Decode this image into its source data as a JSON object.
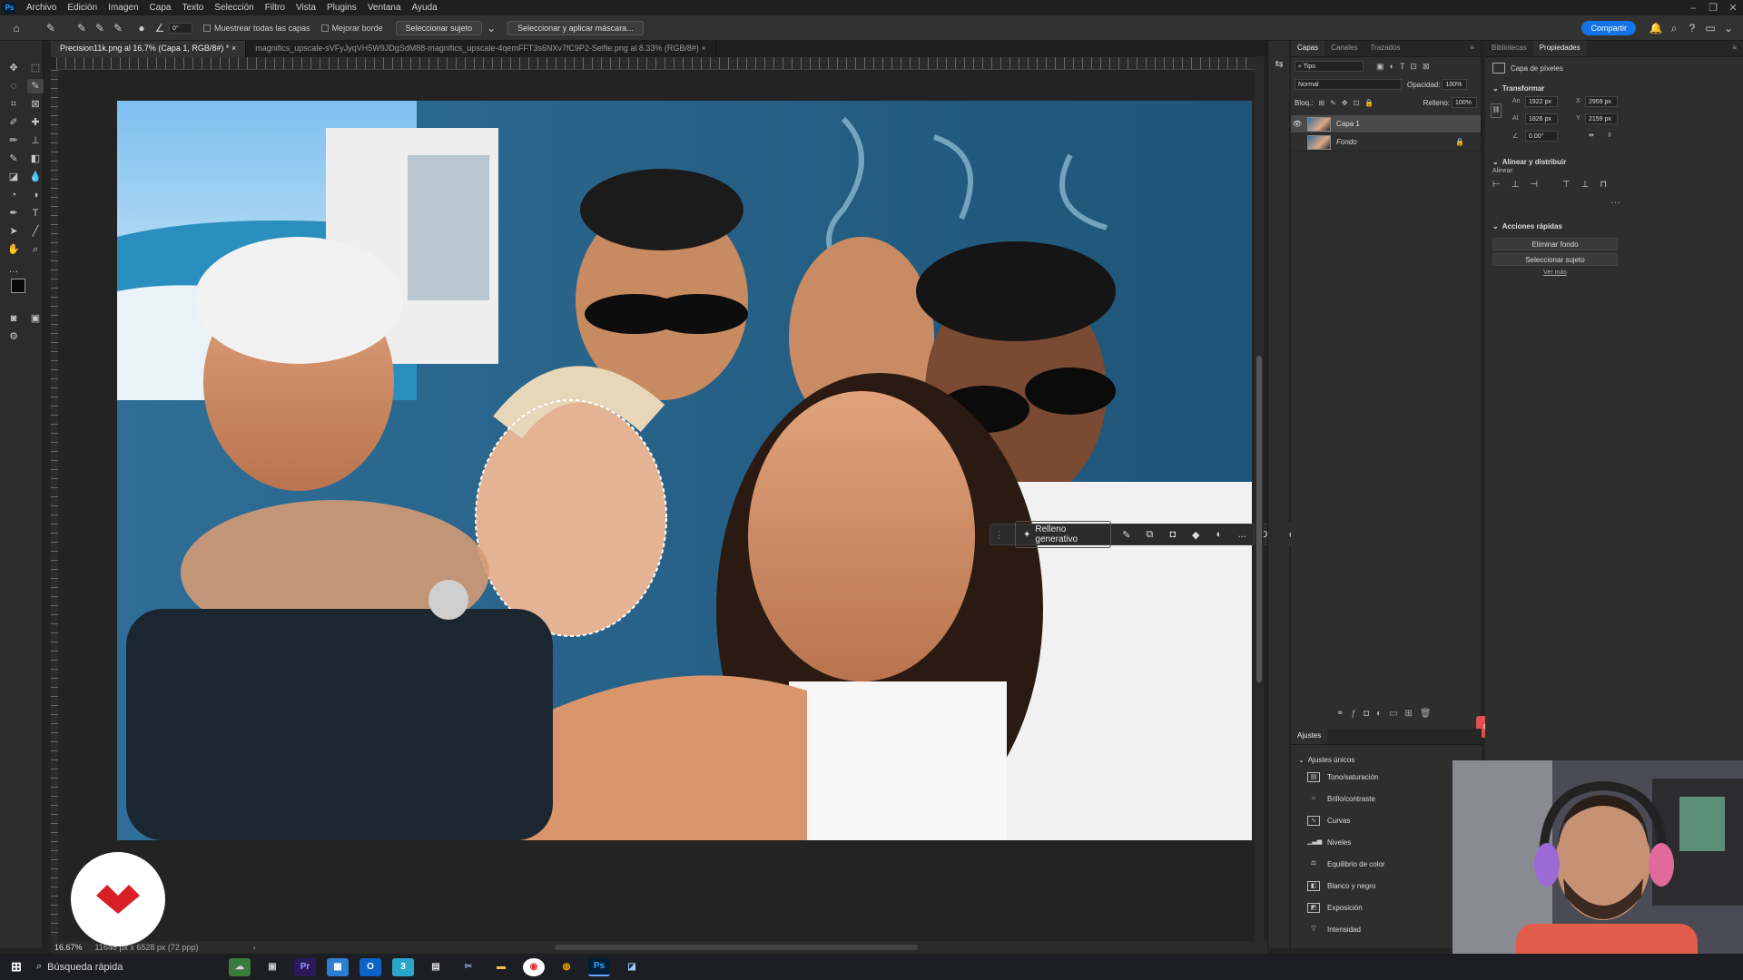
{
  "menubar": {
    "app_badge": "Ps",
    "items": [
      "Archivo",
      "Edición",
      "Imagen",
      "Capa",
      "Texto",
      "Selección",
      "Filtro",
      "Vista",
      "Plugins",
      "Ventana",
      "Ayuda"
    ]
  },
  "options": {
    "brush_size": "0°",
    "sample_all_layers": "Muestrear todas las capas",
    "enhance_edge": "Mejorar borde",
    "select_subject": "Seleccionar sujeto",
    "select_and_mask": "Seleccionar y aplicar máscara...",
    "share": "Compartir"
  },
  "tabs": [
    {
      "label": "Precision11k.png al 16.7% (Capa 1, RGB/8#) *",
      "close": "×"
    },
    {
      "label": "magnifics_upscale-sVFyJyqVH5W9JDgSdM88-magnifics_upscale-4qemFFT3s6NXv7fC9P2-Selfie.png al 8.33% (RGB/8#)",
      "close": "×"
    }
  ],
  "context_bar": {
    "generative_fill": "Relleno generativo",
    "deselect": "Deseleccionar",
    "more": "..."
  },
  "status": {
    "zoom": "16.67%",
    "doc_info": "11648 px x 6528 px (72 ppp)"
  },
  "layers_panel": {
    "tabs": [
      "Capas",
      "Canales",
      "Trazados"
    ],
    "filter": "Tipo",
    "blend_mode": "Normal",
    "opacity_label": "Opacidad:",
    "opacity": "100%",
    "lock_label": "Bloq.:",
    "fill_label": "Relleno:",
    "fill": "100%",
    "layers": [
      {
        "name": "Capa 1",
        "selected": true
      },
      {
        "name": "Fondo",
        "selected": false
      }
    ]
  },
  "props_panel": {
    "tabs": [
      "Bibliotecas",
      "Propiedades"
    ],
    "type": "Capa de píxeles",
    "transform_title": "Transformar",
    "w_label": "An",
    "w": "1922 px",
    "x_label": "X",
    "x": "2959 px",
    "h_label": "Al",
    "h": "1826 px",
    "y_label": "Y",
    "y": "2159 px",
    "angle": "0.00°",
    "align_title": "Alinear y distribuir",
    "align_label": "Alinear:",
    "quick_actions_title": "Acciones rápidas",
    "remove_bg": "Eliminar fondo",
    "select_subject": "Seleccionar sujeto",
    "see_more": "Ver más"
  },
  "adjustments": {
    "tab": "Ajustes",
    "section": "Ajustes únicos",
    "items": [
      {
        "label": "Tono/saturación",
        "icon": "hue-icon"
      },
      {
        "label": "Brillo/contraste",
        "icon": "brightness-icon"
      },
      {
        "label": "Curvas",
        "icon": "curves-icon"
      },
      {
        "label": "Niveles",
        "icon": "levels-icon"
      },
      {
        "label": "Equilibrio de color",
        "icon": "color-balance-icon"
      },
      {
        "label": "Blanco y negro",
        "icon": "black-white-icon"
      },
      {
        "label": "Exposición",
        "icon": "exposure-icon"
      },
      {
        "label": "Intensidad",
        "icon": "vibrance-icon"
      }
    ]
  },
  "taskbar": {
    "search": "Búsqueda rápida"
  },
  "colors": {
    "accent": "#1473e6",
    "brand_red": "#d81f26"
  }
}
